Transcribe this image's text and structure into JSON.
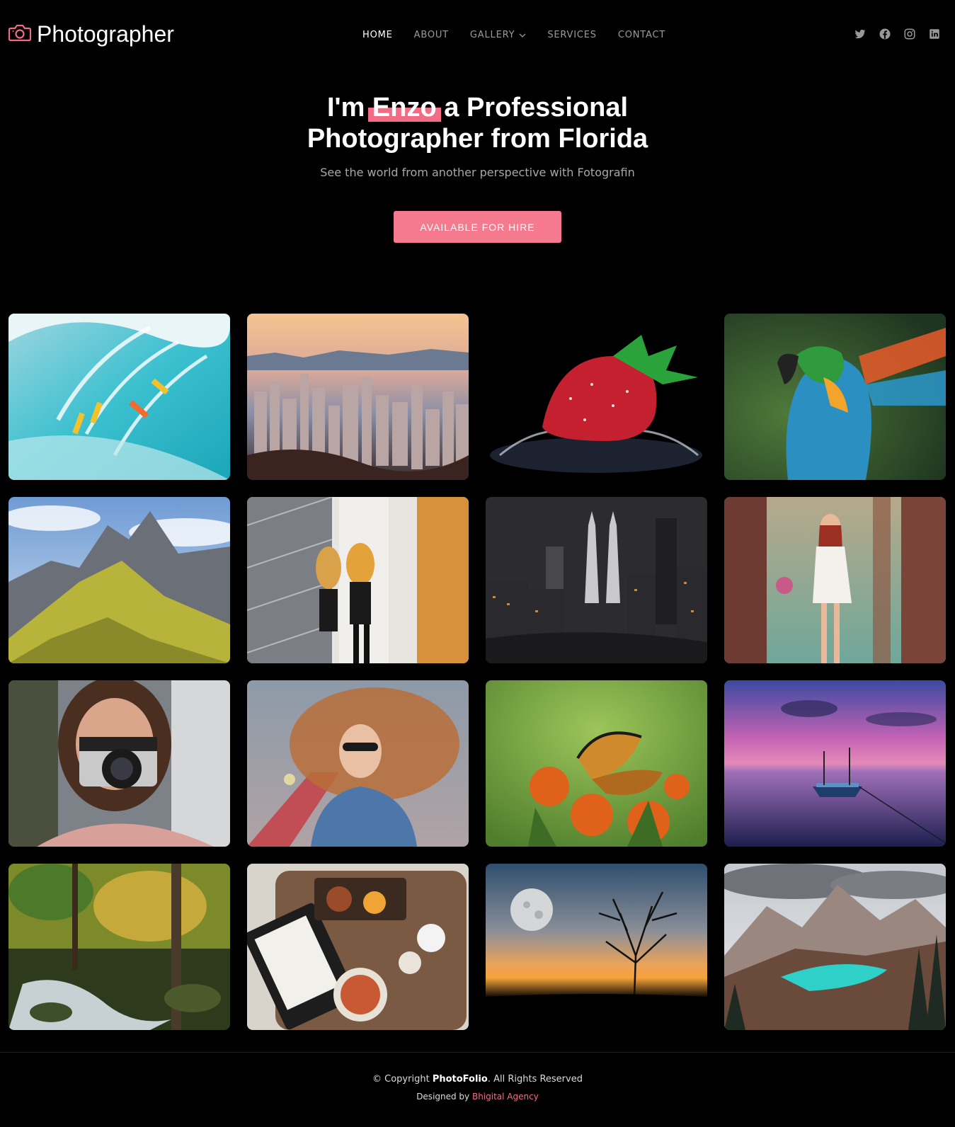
{
  "brand": {
    "name": "Photographer",
    "icon": "camera-icon",
    "accent": "#f26c86"
  },
  "nav": {
    "items": [
      {
        "label": "HOME",
        "active": true
      },
      {
        "label": "ABOUT",
        "active": false
      },
      {
        "label": "GALLERY",
        "active": false,
        "dropdown": true
      },
      {
        "label": "SERVICES",
        "active": false
      },
      {
        "label": "CONTACT",
        "active": false
      }
    ]
  },
  "socials": [
    "twitter-icon",
    "facebook-icon",
    "instagram-icon",
    "linkedin-icon"
  ],
  "hero": {
    "title_before": "I'm ",
    "title_name": "Enzo",
    "title_after": " a Professional",
    "title_line2": "Photographer from Florida",
    "subtitle": "See the world from another perspective with Fotografin",
    "cta_label": "AVAILABLE FOR HIRE"
  },
  "gallery": [
    {
      "name": "surfers-wave-photo"
    },
    {
      "name": "city-skyline-sunset-photo"
    },
    {
      "name": "strawberry-splash-photo"
    },
    {
      "name": "macaw-parrot-photo"
    },
    {
      "name": "mountain-peaks-photo"
    },
    {
      "name": "women-mirror-photo"
    },
    {
      "name": "petronas-towers-night-photo"
    },
    {
      "name": "woman-forest-flowers-photo"
    },
    {
      "name": "woman-camera-photo"
    },
    {
      "name": "woman-red-hair-street-photo"
    },
    {
      "name": "monarch-butterfly-photo"
    },
    {
      "name": "boat-purple-sunset-photo"
    },
    {
      "name": "forest-waterfall-photo"
    },
    {
      "name": "food-table-flatlay-photo"
    },
    {
      "name": "moon-tree-sunset-photo"
    },
    {
      "name": "mountain-lake-photo"
    }
  ],
  "footer": {
    "copyright_prefix": "© Copyright ",
    "copyright_brand": "PhotoFolio",
    "copyright_suffix": ". All Rights Reserved",
    "designed_prefix": "Designed by ",
    "designed_link": "Bhigital Agency"
  }
}
